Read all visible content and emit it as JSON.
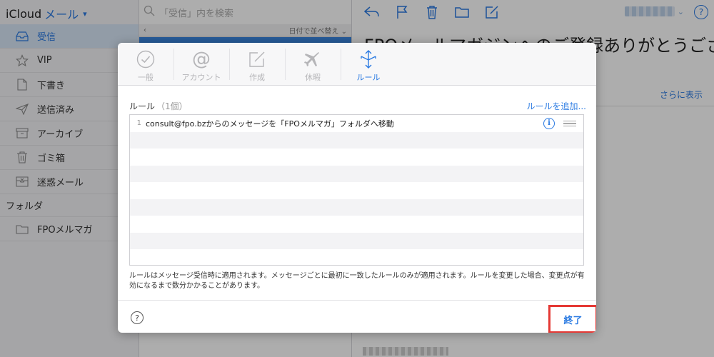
{
  "app": {
    "name": "iCloud",
    "section": "メール"
  },
  "sidebar": {
    "items": [
      {
        "label": "受信",
        "icon": "inbox-icon",
        "active": true
      },
      {
        "label": "VIP",
        "icon": "star-icon"
      },
      {
        "label": "下書き",
        "icon": "document-icon"
      },
      {
        "label": "送信済み",
        "icon": "paper-plane-icon"
      },
      {
        "label": "アーカイブ",
        "icon": "archive-box-icon"
      },
      {
        "label": "ゴミ箱",
        "icon": "trash-icon"
      },
      {
        "label": "迷惑メール",
        "icon": "junk-icon"
      }
    ],
    "folder_section": "フォルダ",
    "folders": [
      {
        "label": "FPOメルマガ",
        "icon": "folder-icon"
      }
    ]
  },
  "message_list": {
    "search_placeholder": "「受信」内を検索",
    "sort_label": "日付で並べ替え"
  },
  "reader": {
    "subject": "FPOメールマガジンへのご登録ありがとうござ",
    "more_label": "さらに表示"
  },
  "modal": {
    "tabs": [
      {
        "label": "一般",
        "icon": "checkmark-circle-icon"
      },
      {
        "label": "アカウント",
        "icon": "at-sign-icon"
      },
      {
        "label": "作成",
        "icon": "compose-icon"
      },
      {
        "label": "休暇",
        "icon": "airplane-icon"
      },
      {
        "label": "ルール",
        "icon": "move-arrows-icon",
        "active": true
      }
    ],
    "rules_title": "ルール",
    "rules_count": "（1個）",
    "add_rule_label": "ルールを追加...",
    "rules": [
      {
        "number": "1",
        "text": "consult@fpo.bzからのメッセージを「FPOメルマガ」フォルダへ移動"
      }
    ],
    "note": "ルールはメッセージ受信時に適用されます。メッセージごとに最初に一致したルールのみが適用されます。ルールを変更した場合、変更点が有効になるまで数分かかることがあります。",
    "help_label": "?",
    "done_label": "終了"
  },
  "colors": {
    "accent": "#2a7ae2",
    "highlight_box": "#e53935",
    "overlay": "rgba(0,0,0,0.32)"
  }
}
